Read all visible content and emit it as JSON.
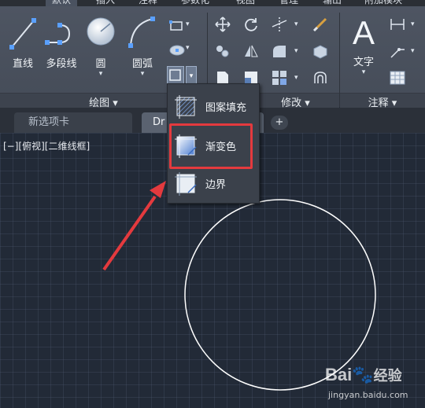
{
  "ribbon_tabs": [
    "默认",
    "插入",
    "注释",
    "参数化",
    "视图",
    "管理",
    "输出",
    "附加模块"
  ],
  "draw_panel": {
    "tools": [
      {
        "label": "直线",
        "icon": "line-icon"
      },
      {
        "label": "多段线",
        "icon": "polyline-icon"
      },
      {
        "label": "圆",
        "icon": "circle-icon"
      },
      {
        "label": "圆弧",
        "icon": "arc-icon"
      }
    ],
    "footer": "绘图 ▾"
  },
  "modify_panel": {
    "footer": "修改 ▾"
  },
  "annotation_panel": {
    "text_tool": "文字",
    "footer": "注释 ▾"
  },
  "doc_tabs": {
    "new_tab": "新选项卡",
    "drawing_tab": "Dr",
    "add": "+"
  },
  "viewport_label": "[−][俯视][二维线框]",
  "hatch_menu": {
    "items": [
      {
        "label": "图案填充",
        "icon": "hatch-pattern-icon"
      },
      {
        "label": "渐变色",
        "icon": "gradient-icon"
      },
      {
        "label": "边界",
        "icon": "boundary-icon"
      }
    ]
  },
  "watermark": {
    "brand": "Bai",
    "brand_cn": "经验",
    "url": "jingyan.baidu.com"
  },
  "colors": {
    "highlight": "#e43a3e",
    "circle": "#ffffff",
    "accent": "#7fa7e6"
  }
}
